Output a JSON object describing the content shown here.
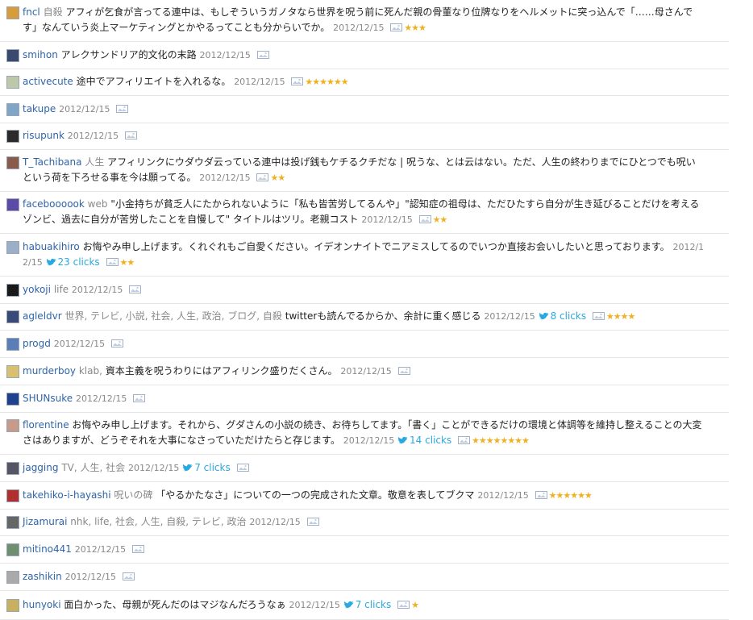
{
  "icon_names": {
    "bird": "twitter-bird-icon",
    "image": "image-icon",
    "star": "star-icon"
  },
  "colors": {
    "username": "#2f64a8",
    "meta": "#888888",
    "twitter": "#2aa9e0",
    "star": "#f0b020"
  },
  "entries": [
    {
      "user": "fncl",
      "tags": "自殺",
      "comment": "アフィが乞食が言ってる連中は、もしぞういうガノタなら世界を呪う前に死んだ親の骨董なり位牌なりをヘルメットに突っ込んで「……母さんです」なんていう炎上マーケティングとかやるってことも分からいでか。",
      "date": "2012/12/15",
      "clicks": "",
      "stars": 3
    },
    {
      "user": "smihon",
      "tags": "",
      "comment": "アレクサンドリア的文化の末路",
      "date": "2012/12/15",
      "clicks": "",
      "stars": 0
    },
    {
      "user": "activecute",
      "tags": "",
      "comment": "途中でアフィリエイトを入れるな。",
      "date": "2012/12/15",
      "clicks": "",
      "stars": 6
    },
    {
      "user": "takupe",
      "tags": "",
      "comment": "",
      "date": "2012/12/15",
      "clicks": "",
      "stars": 0
    },
    {
      "user": "risupunk",
      "tags": "",
      "comment": "",
      "date": "2012/12/15",
      "clicks": "",
      "stars": 0
    },
    {
      "user": "T_Tachibana",
      "tags": "人生",
      "comment": "アフィリンクにウダウダ云っている連中は投げ銭もケチるクチだな | 呪うな、とは云はない。ただ、人生の終わりまでにひとつでも呪いという荷を下ろせる事を今は願ってる。",
      "date": "2012/12/15",
      "clicks": "",
      "stars": 2
    },
    {
      "user": "faceboooook",
      "tags": "web",
      "comment": "\"小金持ちが貧乏人にたかられないように「私も皆苦労してるんや」\"認知症の祖母は、ただひたすら自分が生き延びることだけを考えるゾンビ、過去に自分が苦労したことを自慢して\" タイトルはツリ。老親コスト",
      "date": "2012/12/15",
      "clicks": "",
      "stars": 2
    },
    {
      "user": "habuakihiro",
      "tags": "",
      "comment": "お悔やみ申し上げます。くれぐれもご自愛ください。イデオンナイトでニアミスしてるのでいつか直接お会いしたいと思っております。",
      "date": "2012/12/15",
      "clicks": "23 clicks",
      "stars": 2
    },
    {
      "user": "yokoji",
      "tags": "life",
      "comment": "",
      "date": "2012/12/15",
      "clicks": "",
      "stars": 0
    },
    {
      "user": "agleldvr",
      "tags": "世界, テレビ, 小説, 社会, 人生, 政治, ブログ, 自殺",
      "comment": "twitterも読んでるからか、余計に重く感じる",
      "date": "2012/12/15",
      "clicks": "8 clicks",
      "stars": 4
    },
    {
      "user": "progd",
      "tags": "",
      "comment": "",
      "date": "2012/12/15",
      "clicks": "",
      "stars": 0
    },
    {
      "user": "murderboy",
      "tags": "klab,",
      "comment": "資本主義を呪うわりにはアフィリンク盛りだくさん。",
      "date": "2012/12/15",
      "clicks": "",
      "stars": 0
    },
    {
      "user": "SHUNsuke",
      "tags": "",
      "comment": "",
      "date": "2012/12/15",
      "clicks": "",
      "stars": 0
    },
    {
      "user": "florentine",
      "tags": "",
      "comment": "お悔やみ申し上げます。それから、グダさんの小説の続き、お待ちしてます。「書く」ことができるだけの環境と体調等を維持し整えることの大変さはありますが、どうぞそれを大事になさっていただけたらと存じます。",
      "date": "2012/12/15",
      "clicks": "14 clicks",
      "stars": 8
    },
    {
      "user": "jagging",
      "tags": "TV, 人生, 社会",
      "comment": "",
      "date": "2012/12/15",
      "clicks": "7 clicks",
      "stars": 0
    },
    {
      "user": "takehiko-i-hayashi",
      "tags": "呪いの碑",
      "comment": "「やるかたなさ」についての一つの完成された文章。敬意を表してブクマ",
      "date": "2012/12/15",
      "clicks": "",
      "stars": 6
    },
    {
      "user": "Jizamurai",
      "tags": "nhk, life, 社会, 人生, 自殺, テレビ, 政治",
      "comment": "",
      "date": "2012/12/15",
      "clicks": "",
      "stars": 0
    },
    {
      "user": "mitino441",
      "tags": "",
      "comment": "",
      "date": "2012/12/15",
      "clicks": "",
      "stars": 0
    },
    {
      "user": "zashikin",
      "tags": "",
      "comment": "",
      "date": "2012/12/15",
      "clicks": "",
      "stars": 0
    },
    {
      "user": "hunyoki",
      "tags": "",
      "comment": "面白かった、母親が死んだのはマジなんだろうなぁ",
      "date": "2012/12/15",
      "clicks": "7 clicks",
      "stars": 1
    }
  ]
}
